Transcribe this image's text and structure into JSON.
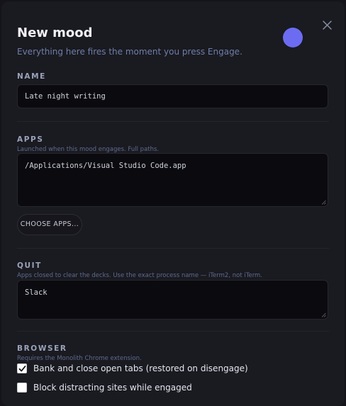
{
  "header": {
    "title": "New mood",
    "subtitle": "Everything here fires the moment you press Engage.",
    "color_dot": "#6c6cf2",
    "close_icon": "close-icon"
  },
  "name_section": {
    "label": "NAME",
    "value": "Late night writing"
  },
  "apps_section": {
    "label": "APPS",
    "hint": "Launched when this mood engages. Full paths.",
    "value": "/Applications/Visual Studio Code.app",
    "choose_button": "CHOOSE APPS..."
  },
  "quit_section": {
    "label": "QUIT",
    "hint": "Apps closed to clear the decks. Use the exact process name — iTerm2, not iTerm.",
    "value": "Slack"
  },
  "browser_section": {
    "label": "BROWSER",
    "hint": "Requires the Monolith Chrome extension.",
    "options": [
      {
        "label": "Bank and close open tabs (restored on disengage)",
        "checked": true
      },
      {
        "label": "Block distracting sites while engaged",
        "checked": false
      }
    ]
  },
  "colors": {
    "accent": "#6c6cf2",
    "background": "#1a1a21",
    "field": "#0b0b0f"
  }
}
